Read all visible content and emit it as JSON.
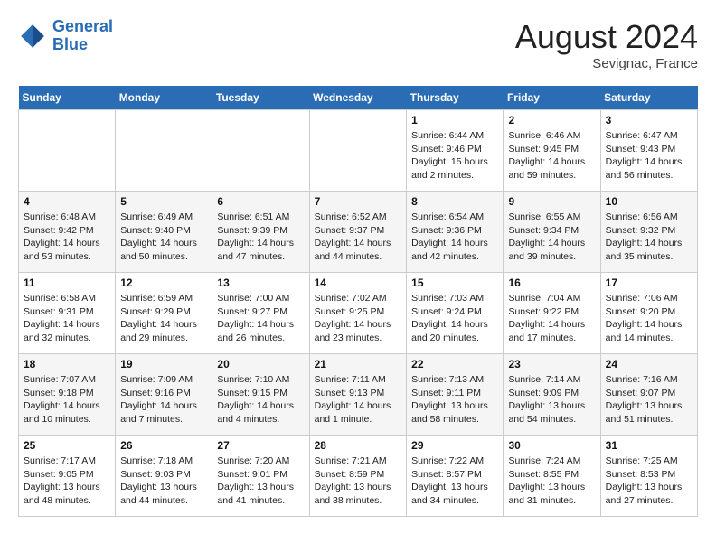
{
  "logo": {
    "line1": "General",
    "line2": "Blue"
  },
  "header": {
    "month_year": "August 2024",
    "location": "Sevignac, France"
  },
  "days_of_week": [
    "Sunday",
    "Monday",
    "Tuesday",
    "Wednesday",
    "Thursday",
    "Friday",
    "Saturday"
  ],
  "weeks": [
    [
      {
        "day": "",
        "info": ""
      },
      {
        "day": "",
        "info": ""
      },
      {
        "day": "",
        "info": ""
      },
      {
        "day": "",
        "info": ""
      },
      {
        "day": "1",
        "info": "Sunrise: 6:44 AM\nSunset: 9:46 PM\nDaylight: 15 hours\nand 2 minutes."
      },
      {
        "day": "2",
        "info": "Sunrise: 6:46 AM\nSunset: 9:45 PM\nDaylight: 14 hours\nand 59 minutes."
      },
      {
        "day": "3",
        "info": "Sunrise: 6:47 AM\nSunset: 9:43 PM\nDaylight: 14 hours\nand 56 minutes."
      }
    ],
    [
      {
        "day": "4",
        "info": "Sunrise: 6:48 AM\nSunset: 9:42 PM\nDaylight: 14 hours\nand 53 minutes."
      },
      {
        "day": "5",
        "info": "Sunrise: 6:49 AM\nSunset: 9:40 PM\nDaylight: 14 hours\nand 50 minutes."
      },
      {
        "day": "6",
        "info": "Sunrise: 6:51 AM\nSunset: 9:39 PM\nDaylight: 14 hours\nand 47 minutes."
      },
      {
        "day": "7",
        "info": "Sunrise: 6:52 AM\nSunset: 9:37 PM\nDaylight: 14 hours\nand 44 minutes."
      },
      {
        "day": "8",
        "info": "Sunrise: 6:54 AM\nSunset: 9:36 PM\nDaylight: 14 hours\nand 42 minutes."
      },
      {
        "day": "9",
        "info": "Sunrise: 6:55 AM\nSunset: 9:34 PM\nDaylight: 14 hours\nand 39 minutes."
      },
      {
        "day": "10",
        "info": "Sunrise: 6:56 AM\nSunset: 9:32 PM\nDaylight: 14 hours\nand 35 minutes."
      }
    ],
    [
      {
        "day": "11",
        "info": "Sunrise: 6:58 AM\nSunset: 9:31 PM\nDaylight: 14 hours\nand 32 minutes."
      },
      {
        "day": "12",
        "info": "Sunrise: 6:59 AM\nSunset: 9:29 PM\nDaylight: 14 hours\nand 29 minutes."
      },
      {
        "day": "13",
        "info": "Sunrise: 7:00 AM\nSunset: 9:27 PM\nDaylight: 14 hours\nand 26 minutes."
      },
      {
        "day": "14",
        "info": "Sunrise: 7:02 AM\nSunset: 9:25 PM\nDaylight: 14 hours\nand 23 minutes."
      },
      {
        "day": "15",
        "info": "Sunrise: 7:03 AM\nSunset: 9:24 PM\nDaylight: 14 hours\nand 20 minutes."
      },
      {
        "day": "16",
        "info": "Sunrise: 7:04 AM\nSunset: 9:22 PM\nDaylight: 14 hours\nand 17 minutes."
      },
      {
        "day": "17",
        "info": "Sunrise: 7:06 AM\nSunset: 9:20 PM\nDaylight: 14 hours\nand 14 minutes."
      }
    ],
    [
      {
        "day": "18",
        "info": "Sunrise: 7:07 AM\nSunset: 9:18 PM\nDaylight: 14 hours\nand 10 minutes."
      },
      {
        "day": "19",
        "info": "Sunrise: 7:09 AM\nSunset: 9:16 PM\nDaylight: 14 hours\nand 7 minutes."
      },
      {
        "day": "20",
        "info": "Sunrise: 7:10 AM\nSunset: 9:15 PM\nDaylight: 14 hours\nand 4 minutes."
      },
      {
        "day": "21",
        "info": "Sunrise: 7:11 AM\nSunset: 9:13 PM\nDaylight: 14 hours\nand 1 minute."
      },
      {
        "day": "22",
        "info": "Sunrise: 7:13 AM\nSunset: 9:11 PM\nDaylight: 13 hours\nand 58 minutes."
      },
      {
        "day": "23",
        "info": "Sunrise: 7:14 AM\nSunset: 9:09 PM\nDaylight: 13 hours\nand 54 minutes."
      },
      {
        "day": "24",
        "info": "Sunrise: 7:16 AM\nSunset: 9:07 PM\nDaylight: 13 hours\nand 51 minutes."
      }
    ],
    [
      {
        "day": "25",
        "info": "Sunrise: 7:17 AM\nSunset: 9:05 PM\nDaylight: 13 hours\nand 48 minutes."
      },
      {
        "day": "26",
        "info": "Sunrise: 7:18 AM\nSunset: 9:03 PM\nDaylight: 13 hours\nand 44 minutes."
      },
      {
        "day": "27",
        "info": "Sunrise: 7:20 AM\nSunset: 9:01 PM\nDaylight: 13 hours\nand 41 minutes."
      },
      {
        "day": "28",
        "info": "Sunrise: 7:21 AM\nSunset: 8:59 PM\nDaylight: 13 hours\nand 38 minutes."
      },
      {
        "day": "29",
        "info": "Sunrise: 7:22 AM\nSunset: 8:57 PM\nDaylight: 13 hours\nand 34 minutes."
      },
      {
        "day": "30",
        "info": "Sunrise: 7:24 AM\nSunset: 8:55 PM\nDaylight: 13 hours\nand 31 minutes."
      },
      {
        "day": "31",
        "info": "Sunrise: 7:25 AM\nSunset: 8:53 PM\nDaylight: 13 hours\nand 27 minutes."
      }
    ]
  ]
}
